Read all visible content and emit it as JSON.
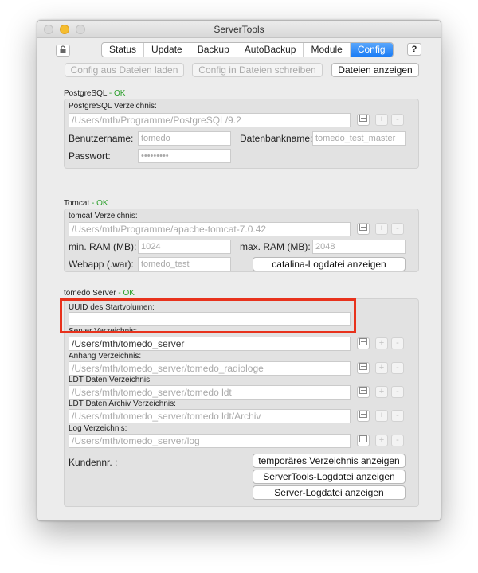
{
  "window": {
    "title": "ServerTools"
  },
  "tabs": [
    {
      "label": "Status",
      "active": false
    },
    {
      "label": "Update",
      "active": false
    },
    {
      "label": "Backup",
      "active": false
    },
    {
      "label": "AutoBackup",
      "active": false
    },
    {
      "label": "Module",
      "active": false
    },
    {
      "label": "Config",
      "active": true
    }
  ],
  "toolbar": {
    "help_label": "?",
    "load_config": "Config aus Dateien laden",
    "write_config": "Config in Dateien schreiben",
    "show_files": "Dateien anzeigen"
  },
  "postgres": {
    "title": "PostgreSQL",
    "status": "- OK",
    "dir_label": "PostgreSQL Verzeichnis:",
    "dir_value": "/Users/mth/Programme/PostgreSQL/9.2",
    "user_label": "Benutzername:",
    "user_value": "tomedo",
    "db_label": "Datenbankname:",
    "db_value": "tomedo_test_master",
    "pass_label": "Passwort:",
    "pass_value": "•••••••••"
  },
  "tomcat": {
    "title": "Tomcat",
    "status": "- OK",
    "dir_label": "tomcat Verzeichnis:",
    "dir_value": "/Users/mth/Programme/apache-tomcat-7.0.42",
    "minram_label": "min. RAM (MB):",
    "minram_value": "1024",
    "maxram_label": "max. RAM (MB):",
    "maxram_value": "2048",
    "webapp_label": "Webapp (.war):",
    "webapp_value": "tomedo_test",
    "catalina_button": "catalina-Logdatei anzeigen"
  },
  "server": {
    "title": "tomedo Server",
    "status": "- OK",
    "uuid_label": "UUID des Startvolumen:",
    "uuid_value": "",
    "server_dir_label": "Server Verzeichnis:",
    "server_dir_value": "/Users/mth/tomedo_server",
    "anhang_label": "Anhang Verzeichnis:",
    "anhang_value": "/Users/mth/tomedo_server/tomedo_radiologe",
    "ldt_label": "LDT Daten Verzeichnis:",
    "ldt_value": "/Users/mth/tomedo_server/tomedo ldt",
    "ldt_archiv_label": "LDT Daten Archiv Verzeichnis:",
    "ldt_archiv_value": "/Users/mth/tomedo_server/tomedo ldt/Archiv",
    "log_label": "Log Verzeichnis:",
    "log_value": "/Users/mth/tomedo_server/log",
    "kunden_label": "Kundennr. :",
    "btn_temp": "temporäres Verzeichnis anzeigen",
    "btn_servertools_log": "ServerTools-Logdatei anzeigen",
    "btn_server_log": "Server-Logdatei anzeigen"
  },
  "mini_buttons": {
    "plus": "+",
    "minus": "-"
  },
  "colors": {
    "accent": "#1a7cf5",
    "ok": "#2ca02c",
    "highlight": "#e8321c"
  }
}
